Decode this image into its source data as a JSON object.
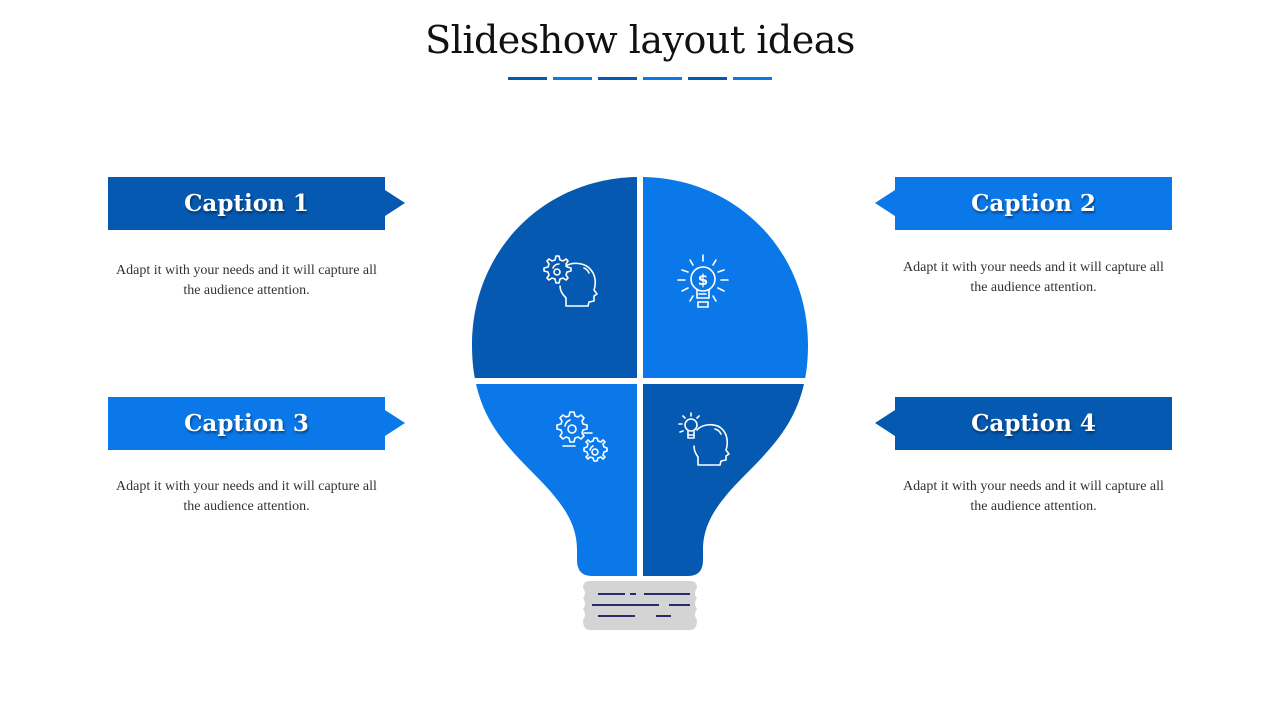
{
  "title": "Slideshow layout ideas",
  "colors": {
    "dark_blue": "#0559B0",
    "light_blue": "#0A78E8",
    "base_gray": "#D4D4D4",
    "base_lines": "#2B2A6B"
  },
  "title_dashes": [
    "dark_blue",
    "light_blue",
    "dark_blue",
    "light_blue",
    "dark_blue",
    "light_blue"
  ],
  "captions": [
    {
      "label": "Caption 1",
      "text": "Adapt it with your needs and it will capture all the audience attention.",
      "color": "dark_blue",
      "icon": "gear-head-icon"
    },
    {
      "label": "Caption 2",
      "text": "Adapt it with your needs and it will capture all the audience attention.",
      "color": "light_blue",
      "icon": "dollar-bulb-icon"
    },
    {
      "label": "Caption 3",
      "text": "Adapt it with your needs and it will capture all the audience attention.",
      "color": "light_blue",
      "icon": "gears-icon"
    },
    {
      "label": "Caption 4",
      "text": "Adapt it with your needs and it will capture all the audience attention.",
      "color": "dark_blue",
      "icon": "bulb-head-icon"
    }
  ]
}
